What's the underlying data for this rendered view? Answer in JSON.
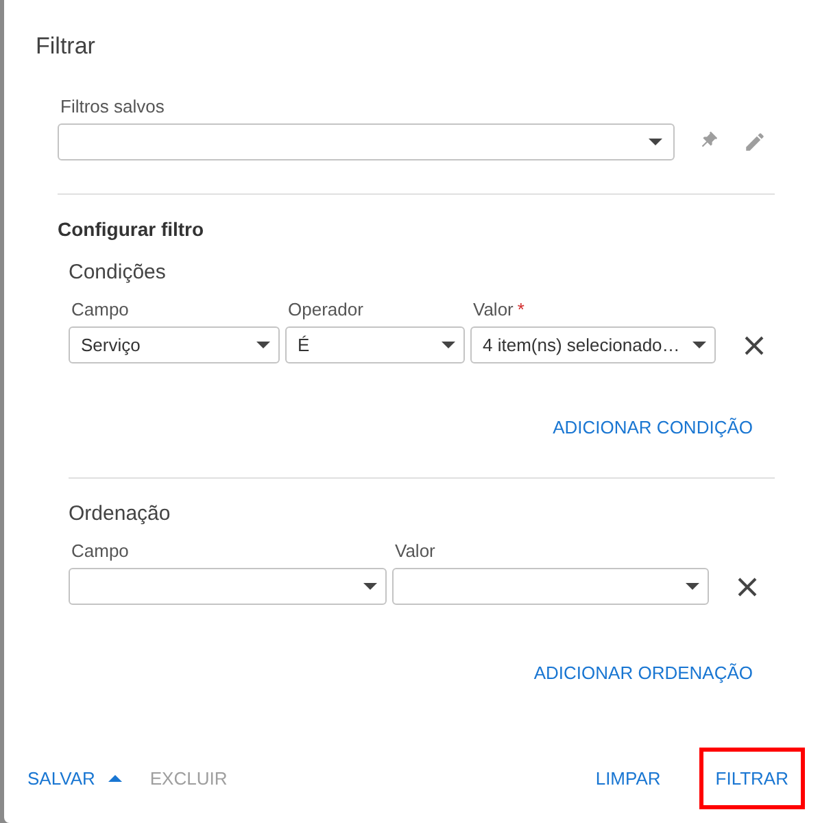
{
  "dialog": {
    "title": "Filtrar"
  },
  "saved_filters": {
    "label": "Filtros salvos"
  },
  "section_title": "Configurar filtro",
  "conditions": {
    "title": "Condições",
    "columns": [
      {
        "label": "Campo"
      },
      {
        "label": "Operador"
      },
      {
        "label": "Valor",
        "required_mark": "*"
      }
    ],
    "rows": [
      {
        "values": [
          "Serviço",
          "É",
          "4 item(ns) selecionado…"
        ]
      }
    ],
    "add_button": "ADICIONAR CONDIÇÃO"
  },
  "sorting": {
    "title": "Ordenação",
    "columns": [
      {
        "label": "Campo"
      },
      {
        "label": "Valor"
      }
    ],
    "add_button": "ADICIONAR ORDENAÇÃO"
  },
  "footer": {
    "buttons": [
      {
        "label": "SALVAR",
        "kind": "menu",
        "disabled": false,
        "highlighted": false
      },
      {
        "label": "EXCLUIR",
        "kind": "plain",
        "disabled": true,
        "highlighted": false
      },
      {
        "label": "LIMPAR",
        "kind": "plain",
        "disabled": false,
        "highlighted": false
      },
      {
        "label": "FILTRAR",
        "kind": "plain",
        "disabled": false,
        "highlighted": true
      }
    ]
  }
}
